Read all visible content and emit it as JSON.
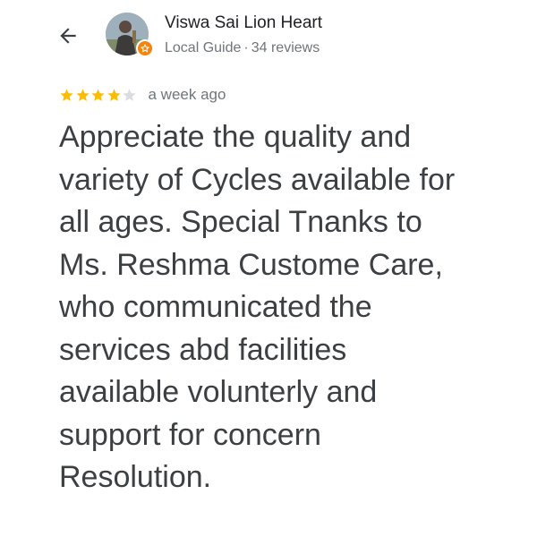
{
  "header": {
    "back_icon": "arrow-left-icon"
  },
  "reviewer": {
    "name": "Viswa Sai Lion Heart",
    "badge_icon": "local-guide-star-icon",
    "badge_color": "#f4840c",
    "guide_label": "Local Guide",
    "separator": "·",
    "review_count": "34 reviews"
  },
  "review": {
    "rating": 4,
    "max_rating": 5,
    "star_color_filled": "#fbbc04",
    "star_color_empty": "#dadce0",
    "date": "a week ago",
    "lines": [
      "Appreciate the quality and",
      "variety of Cycles available for",
      "all ages. Special Tnanks to",
      "Ms. Reshma Custome Care,",
      "who communicated the",
      "services abd facilities",
      "available volunterly and",
      "support for concern",
      "Resolution."
    ]
  }
}
